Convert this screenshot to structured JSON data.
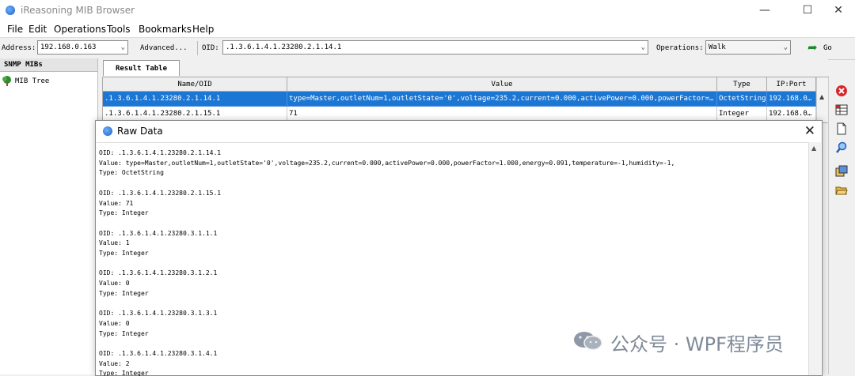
{
  "window": {
    "title": "iReasoning MIB Browser",
    "minimize": "—",
    "maximize": "☐",
    "close": "✕"
  },
  "menu": [
    "File",
    "Edit",
    "Operations",
    "Tools",
    "Bookmarks",
    "Help"
  ],
  "toolbar": {
    "address_label": "Address:",
    "address_value": "192.168.0.163",
    "advanced_label": "Advanced...",
    "oid_label": "OID:",
    "oid_value": ".1.3.6.1.4.1.23280.2.1.14.1",
    "operations_label": "Operations:",
    "operations_value": "Walk",
    "go_label": "Go"
  },
  "left_panel": {
    "header": "SNMP MIBs",
    "tree_item": "MIB Tree"
  },
  "tabs": {
    "result_table": "Result Table"
  },
  "table": {
    "columns": [
      "Name/OID",
      "Value",
      "Type",
      "IP:Port"
    ],
    "rows": [
      {
        "oid": ".1.3.6.1.4.1.23280.2.1.14.1",
        "value": "type=Master,outletNum=1,outletState='0',voltage=235.2,current=0.000,activePower=0.000,powerFactor=1.000...",
        "type": "OctetString",
        "ip": "192.168.0..."
      },
      {
        "oid": ".1.3.6.1.4.1.23280.2.1.15.1",
        "value": "71",
        "type": "Integer",
        "ip": "192.168.0..."
      }
    ]
  },
  "dialog": {
    "title": "Raw Data",
    "close": "✕",
    "lines": [
      "OID: .1.3.6.1.4.1.23280.2.1.14.1",
      "Value: type=Master,outletNum=1,outletState='0',voltage=235.2,current=0.000,activePower=0.000,powerFactor=1.000,energy=0.091,temperature=-1,humidity=-1,",
      "Type: OctetString",
      "",
      "OID: .1.3.6.1.4.1.23280.2.1.15.1",
      "Value: 71",
      "Type: Integer",
      "",
      "OID: .1.3.6.1.4.1.23280.3.1.1.1",
      "Value: 1",
      "Type: Integer",
      "",
      "OID: .1.3.6.1.4.1.23280.3.1.2.1",
      "Value: 0",
      "Type: Integer",
      "",
      "OID: .1.3.6.1.4.1.23280.3.1.3.1",
      "Value: 0",
      "Type: Integer",
      "",
      "OID: .1.3.6.1.4.1.23280.3.1.4.1",
      "Value: 2",
      "Type: Integer"
    ]
  },
  "right_toolbar": [
    "delete-icon",
    "table-icon",
    "document-icon",
    "find-icon",
    "export-icon",
    "open-folder-icon"
  ],
  "watermark": {
    "text": "公众号 · WPF程序员"
  },
  "colors": {
    "selection": "#1c76d3",
    "go_arrow": "#1a8a2a",
    "delete": "#d9262c"
  }
}
